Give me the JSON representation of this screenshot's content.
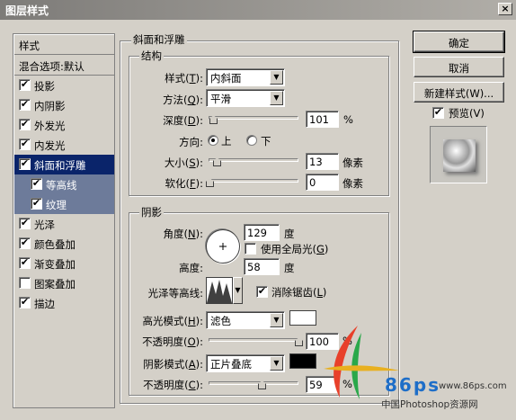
{
  "window": {
    "title": "图层样式",
    "close": "×"
  },
  "sidebar": {
    "header": "样式",
    "blend_options": "混合选项:默认",
    "items": [
      {
        "label": "投影",
        "checked": true
      },
      {
        "label": "内阴影",
        "checked": true
      },
      {
        "label": "外发光",
        "checked": true
      },
      {
        "label": "内发光",
        "checked": true
      },
      {
        "label": "斜面和浮雕",
        "checked": true,
        "selected": true
      },
      {
        "label": "等高线",
        "checked": true,
        "sub": true
      },
      {
        "label": "纹理",
        "checked": true,
        "sub": true
      },
      {
        "label": "光泽",
        "checked": true
      },
      {
        "label": "颜色叠加",
        "checked": true
      },
      {
        "label": "渐变叠加",
        "checked": true
      },
      {
        "label": "图案叠加",
        "checked": false
      },
      {
        "label": "描边",
        "checked": true
      }
    ]
  },
  "bevel": {
    "title": "斜面和浮雕",
    "structure": {
      "title": "结构",
      "style_label": "样式(",
      "style_key": "T",
      "style_value": "内斜面",
      "technique_label": "方法(",
      "technique_key": "Q",
      "technique_value": "平滑",
      "depth_label": "深度(",
      "depth_key": "D",
      "depth_value": "101",
      "depth_unit": "%",
      "depth_fraction": 0.1,
      "direction_label": "方向:",
      "dir_up": "上",
      "dir_down": "下",
      "size_label": "大小(",
      "size_key": "S",
      "size_value": "13",
      "size_unit": "像素",
      "soften_label": "软化(",
      "soften_key": "F",
      "soften_value": "0",
      "soften_unit": "像素"
    },
    "shading": {
      "title": "阴影",
      "angle_label": "角度(",
      "angle_key": "N",
      "angle_value": "129",
      "angle_unit": "度",
      "global_light": "使用全局光(",
      "global_key": "G",
      "altitude_label": "高度:",
      "altitude_value": "58",
      "altitude_unit": "度",
      "gloss_label": "光泽等高线:",
      "antialias": "消除锯齿(",
      "antialias_key": "L",
      "highlight_label": "高光模式(",
      "highlight_key": "H",
      "highlight_value": "滤色",
      "highlight_color": "#ffffff",
      "opacity1_label": "不透明度(",
      "opacity1_key": "O",
      "opacity1_value": "100",
      "opacity_unit": "%",
      "shadow_label": "阴影模式(",
      "shadow_key": "A",
      "shadow_value": "正片叠底",
      "shadow_color": "#000000",
      "opacity2_label": "不透明度(",
      "opacity2_key": "C",
      "opacity2_value": "59"
    }
  },
  "buttons": {
    "ok": "确定",
    "cancel": "取消",
    "new_style": "新建样式(W)...",
    "preview": "预览(V)"
  },
  "watermark": {
    "brand": "86ps",
    "site": "www.86ps.com",
    "caption": "中国Photoshop资源网"
  }
}
